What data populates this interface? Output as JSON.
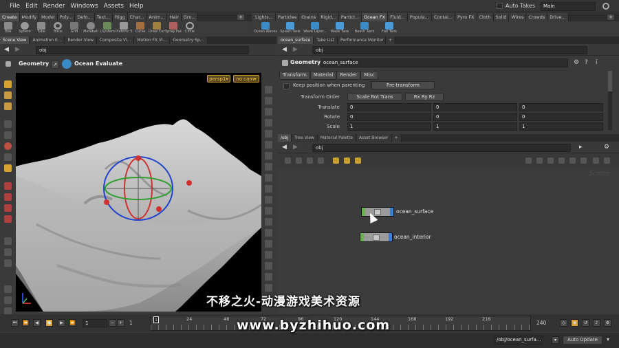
{
  "menu": [
    "File",
    "Edit",
    "Render",
    "Windows",
    "Assets",
    "Help"
  ],
  "menu_right": {
    "auto_takes": "Auto Takes",
    "takes_value": "Main"
  },
  "shelf_left_tabs": [
    "Create",
    "Modify",
    "Model",
    "Poly...",
    "Defo...",
    "Text...",
    "Rigg",
    "Char...",
    "Anim...",
    "Hair",
    "Gro..."
  ],
  "shelf_right_tabs": [
    "Lights...",
    "Particles",
    "Grains",
    "Rigid...",
    "Particl...",
    "Ocean FX",
    "Fluid...",
    "Popula...",
    "Contai...",
    "Pyro FX",
    "Cloth",
    "Solid",
    "Wires",
    "Crowds",
    "Drive..."
  ],
  "tools_left": [
    "Box",
    "Sphere",
    "Tube",
    "Torus",
    "Grid",
    "Metaball",
    "LSystem",
    "Platonic Sol...",
    "Curve",
    "Draw Curve",
    "Spray Paint",
    "Circle"
  ],
  "tools_right": [
    "Ocean Waves",
    "Splash Tank",
    "Wave Layer...",
    "Wave Tank",
    "Beach Tank",
    "Flat Tank"
  ],
  "left_panel": {
    "tabs": [
      "Scene View",
      "Animation E...",
      "Render View",
      "Composite Vi...",
      "Motion FX Vi...",
      "Geometry Sp..."
    ],
    "path": "obj",
    "context": "Geometry",
    "op_label": "Ocean Evaluate",
    "camera_btn": "persp1▾",
    "nocam_btn": "no cam▾"
  },
  "param_panel": {
    "tabs": [
      "ocean_surface",
      "Take List",
      "Performance Monitor"
    ],
    "path": "obj",
    "type_label": "Geometry",
    "node_name": "ocean_surface",
    "subtabs": [
      "Transform",
      "Material",
      "Render",
      "Misc"
    ],
    "keep_position": "Keep position when parenting",
    "pretransform_btn": "Pre-transform",
    "transform_order_label": "Transform Order",
    "transform_order_value": "Scale Rot Trans",
    "rot_order_value": "Rx Ry Rz",
    "rows": [
      {
        "label": "Translate",
        "v1": "0",
        "v2": "0",
        "v3": "0"
      },
      {
        "label": "Rotate",
        "v1": "0",
        "v2": "0",
        "v3": "0"
      },
      {
        "label": "Scale",
        "v1": "1",
        "v2": "1",
        "v3": "1"
      }
    ]
  },
  "network_panel": {
    "tabs": [
      "/obj",
      "Tree View",
      "Material Palette",
      "Asset Browser"
    ],
    "path": "obj",
    "watermark": "Scene",
    "nodes": [
      {
        "name": "ocean_surface",
        "color": "#6ab04c"
      },
      {
        "name": "ocean_interior",
        "color": "#6ab04c"
      }
    ]
  },
  "timeline": {
    "current_frame": "1",
    "start_frame": "1",
    "end_frame": "240",
    "ticks": [
      "1",
      "24",
      "48",
      "72",
      "96",
      "120",
      "144",
      "168",
      "192",
      "216"
    ],
    "range_field": "1"
  },
  "statusbar": {
    "path": "/obj/ocean_surfa...",
    "auto_update": "Auto Update"
  },
  "watermark_text": {
    "line1": "不移之火-动漫游戏美术资源",
    "line2": "www.byzhihuo.com"
  },
  "colors": {
    "accent_orange": "#d8a030",
    "node_bar_blue": "#3b7fd4",
    "viewport_bg": "#000000"
  }
}
